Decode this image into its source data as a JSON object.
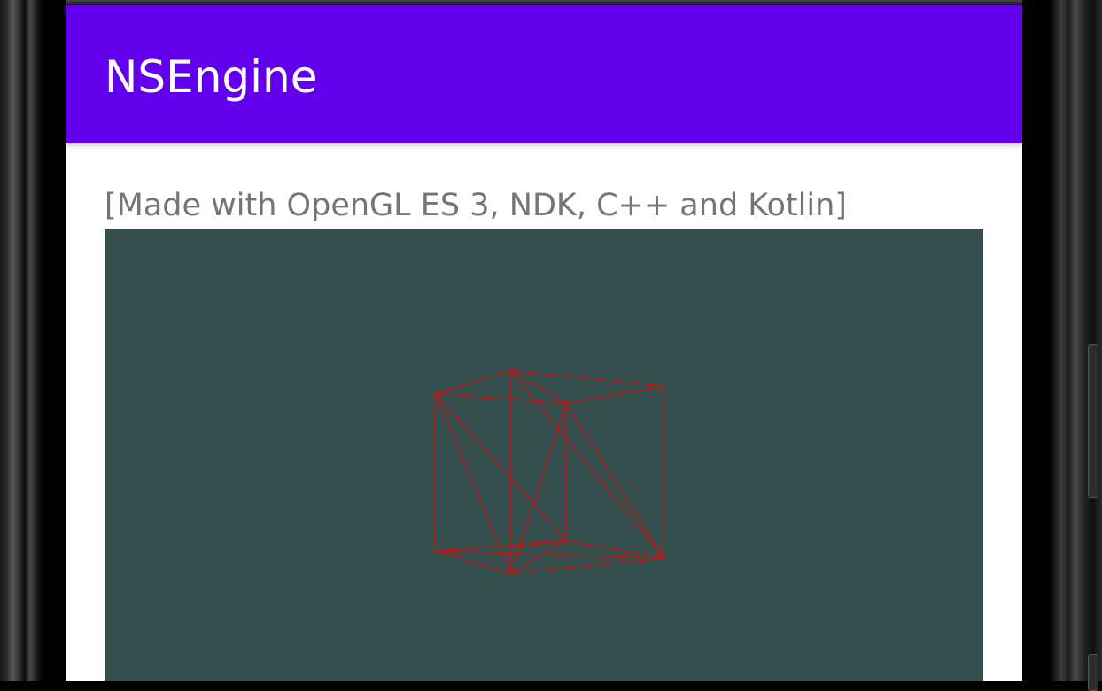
{
  "app": {
    "title": "NSEngine"
  },
  "main": {
    "subtitle": "[Made with OpenGL ES 3, NDK, C++ and Kotlin]"
  },
  "colors": {
    "app_bar": "#6200ee",
    "app_title_text": "#ffffff",
    "subtitle_text": "#757575",
    "gl_clear_color": "#354e4e",
    "wireframe": "#cc1111"
  },
  "render": {
    "object": "wireframe-cube",
    "mode": "wireframe"
  }
}
